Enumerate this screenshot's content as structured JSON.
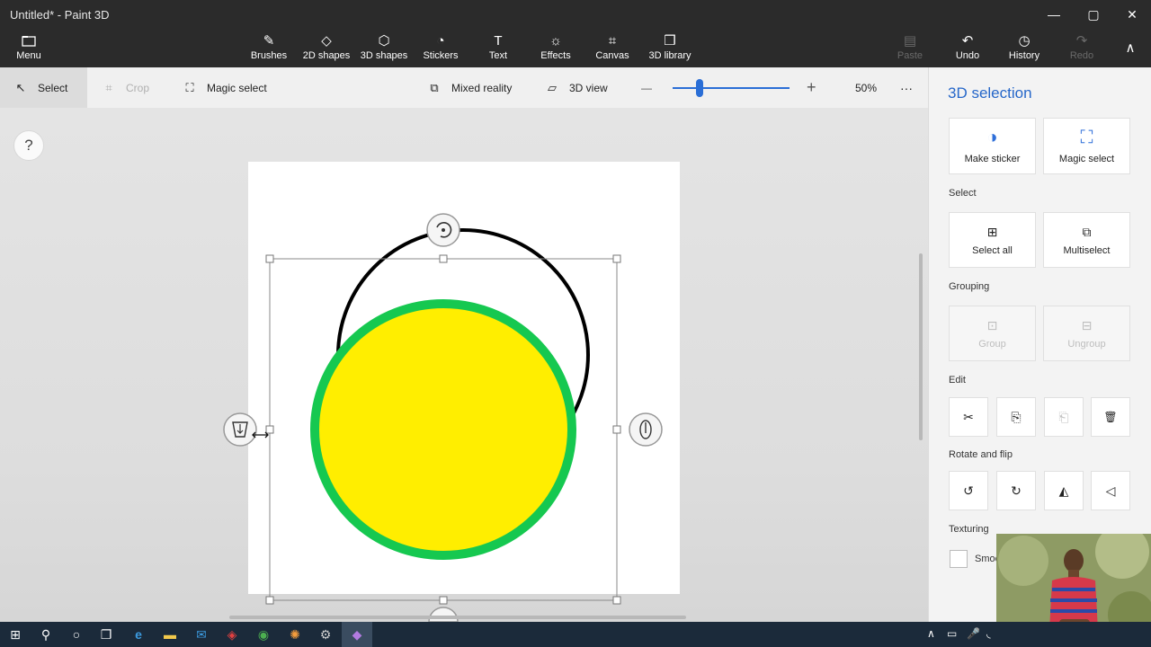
{
  "window": {
    "title": "Untitled* - Paint 3D"
  },
  "window_controls": {
    "minimize": "—",
    "maximize": "▢",
    "close": "✕"
  },
  "ribbon": {
    "menu": {
      "label": "Menu",
      "icon": "folder-icon"
    },
    "tools": [
      {
        "label": "Brushes",
        "icon": "brush-icon",
        "glyph": "✎"
      },
      {
        "label": "2D shapes",
        "icon": "shapes-2d-icon",
        "glyph": "◇"
      },
      {
        "label": "3D shapes",
        "icon": "cube-icon",
        "glyph": "⬡"
      },
      {
        "label": "Stickers",
        "icon": "sticker-icon",
        "glyph": "◔"
      },
      {
        "label": "Text",
        "icon": "text-icon",
        "glyph": "T"
      },
      {
        "label": "Effects",
        "icon": "sun-icon",
        "glyph": "☼"
      },
      {
        "label": "Canvas",
        "icon": "canvas-icon",
        "glyph": "⌗"
      },
      {
        "label": "3D library",
        "icon": "library-icon",
        "glyph": "❒"
      }
    ],
    "paste": {
      "label": "Paste",
      "glyph": "▤"
    },
    "undo": {
      "label": "Undo",
      "glyph": "↶"
    },
    "history": {
      "label": "History",
      "glyph": "◷"
    },
    "redo": {
      "label": "Redo",
      "glyph": "↷"
    },
    "collapse": {
      "glyph": "∧"
    }
  },
  "toolbar": {
    "select": {
      "label": "Select",
      "glyph": "↖"
    },
    "crop": {
      "label": "Crop",
      "glyph": "⌗"
    },
    "magic_select": {
      "label": "Magic select",
      "glyph": "⛶"
    },
    "mixed_reality": {
      "label": "Mixed reality",
      "glyph": "⧉"
    },
    "view_3d": {
      "label": "3D view",
      "glyph": "▱"
    },
    "zoom_out": "—",
    "zoom_in": "+",
    "zoom": "50%",
    "more": "···",
    "zoom_fraction": 0.23
  },
  "canvas": {
    "help": "?",
    "shapes": [
      {
        "type": "circle-outline",
        "stroke": "#000000"
      },
      {
        "type": "circle",
        "fill": "#ffee00",
        "stroke": "#16c850"
      }
    ]
  },
  "panel": {
    "title": "3D selection",
    "top_cards": [
      {
        "label": "Make sticker",
        "glyph": "◑"
      },
      {
        "label": "Magic select",
        "glyph": "⛶"
      }
    ],
    "select_label": "Select",
    "select_cards": [
      {
        "label": "Select all",
        "glyph": "⊞"
      },
      {
        "label": "Multiselect",
        "glyph": "⧉"
      }
    ],
    "grouping_label": "Grouping",
    "grouping_cards": [
      {
        "label": "Group",
        "glyph": "⊡"
      },
      {
        "label": "Ungroup",
        "glyph": "⊟"
      }
    ],
    "edit_label": "Edit",
    "edit_buttons": [
      {
        "name": "cut",
        "glyph": "✂"
      },
      {
        "name": "copy",
        "glyph": "⎘"
      },
      {
        "name": "paste",
        "glyph": "⎗"
      },
      {
        "name": "delete",
        "glyph": "🗑"
      }
    ],
    "rotate_label": "Rotate and flip",
    "rotate_buttons": [
      {
        "name": "rotate-left",
        "glyph": "↺"
      },
      {
        "name": "rotate-right",
        "glyph": "↻"
      },
      {
        "name": "flip-horizontal",
        "glyph": "◭"
      },
      {
        "name": "flip-vertical",
        "glyph": "◁"
      }
    ],
    "texturing_label": "Texturing",
    "smooth_label": "Smoo"
  },
  "taskbar": {
    "items": [
      {
        "name": "start",
        "glyph": "⊞"
      },
      {
        "name": "search",
        "glyph": "⚲"
      },
      {
        "name": "cortana",
        "glyph": "○"
      },
      {
        "name": "task-view",
        "glyph": "❐"
      },
      {
        "name": "edge",
        "glyph": "e"
      },
      {
        "name": "explorer",
        "glyph": "▬"
      },
      {
        "name": "mail",
        "glyph": "✉"
      },
      {
        "name": "mcafee",
        "glyph": "◈"
      },
      {
        "name": "chrome",
        "glyph": "◉"
      },
      {
        "name": "blender",
        "glyph": "✺"
      },
      {
        "name": "settings",
        "glyph": "⚙"
      },
      {
        "name": "paint3d",
        "glyph": "◆"
      }
    ],
    "tray": [
      "∧",
      "▭",
      "🎤",
      "◟"
    ]
  },
  "colors": {
    "accent": "#2667c9",
    "ribbon": "#2b2b2b",
    "yellow": "#ffee00",
    "green": "#16c850"
  }
}
